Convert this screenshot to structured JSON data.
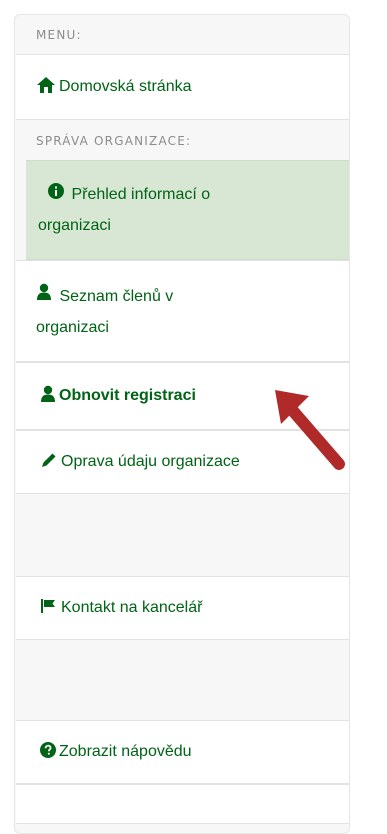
{
  "menu": {
    "header": "MENU:",
    "home": "Domovská stránka",
    "section": "SPRÁVA ORGANIZACE:",
    "items": [
      {
        "label_line1": "Přehled informací o",
        "label_line2": "organizaci"
      },
      {
        "label_line1": "Seznam členů v",
        "label_line2": "organizaci"
      },
      {
        "label": "Obnovit registraci"
      },
      {
        "label": "Oprava údaju organizace"
      },
      {
        "label": "Kontakt na kancelář"
      },
      {
        "label": "Zobrazit nápovědu"
      }
    ]
  },
  "colors": {
    "accent": "#006315",
    "active_bg": "#d8e6d4",
    "arrow": "#b02a2a"
  },
  "icons": [
    "home-icon",
    "info-circle-icon",
    "user-icon",
    "user-icon",
    "pencil-icon",
    "flag-icon",
    "question-circle-icon"
  ]
}
